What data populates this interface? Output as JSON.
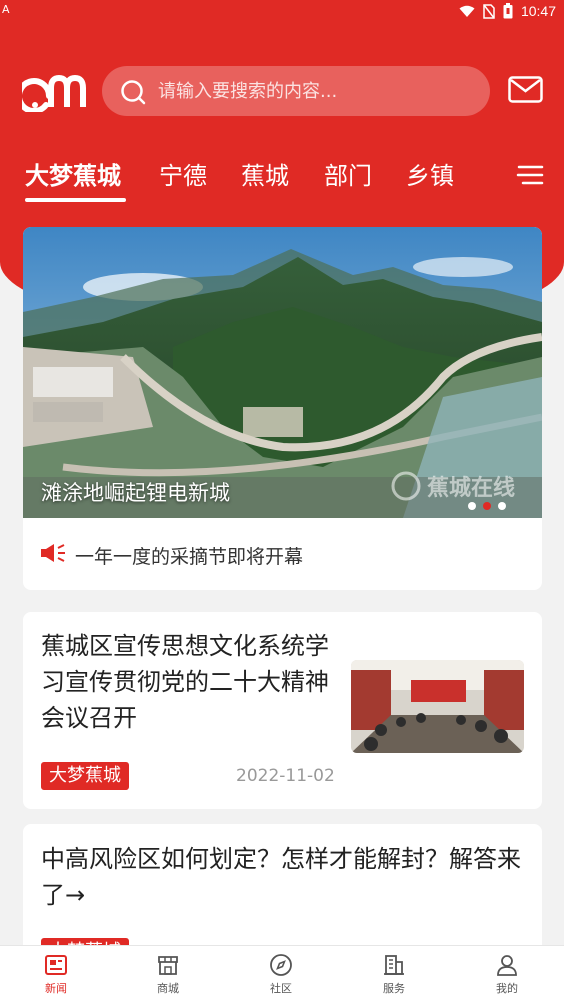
{
  "status_bar": {
    "left_icon": "A",
    "time": "10:47",
    "icons": [
      "wifi-icon",
      "sim-off-icon",
      "battery-icon"
    ]
  },
  "header": {
    "logo": "am",
    "search_placeholder": "请输入要搜索的内容...",
    "icons": [
      "search-icon",
      "mail-icon",
      "menu-icon"
    ]
  },
  "tabs": [
    {
      "label": "大梦蕉城",
      "active": true
    },
    {
      "label": "宁德",
      "active": false
    },
    {
      "label": "蕉城",
      "active": false
    },
    {
      "label": "部门",
      "active": false
    },
    {
      "label": "乡镇",
      "active": false
    }
  ],
  "banner": {
    "caption": "滩涂地崛起锂电新城",
    "watermark": "蕉城在线",
    "slide_count": 3,
    "active_slide": 2
  },
  "notice": {
    "text": "一年一度的采摘节即将开幕"
  },
  "news": [
    {
      "title": "蕉城区宣传思想文化系统学习宣传贯彻党的二十大精神会议召开",
      "tag": "大梦蕉城",
      "date": "2022-11-02"
    },
    {
      "title": "中高风险区如何划定？怎样才能解封？解答来了→",
      "tag": "大梦蕉城"
    }
  ],
  "bottom_nav": [
    {
      "label": "新闻",
      "icon": "news-icon",
      "active": true
    },
    {
      "label": "商城",
      "icon": "store-icon",
      "active": false
    },
    {
      "label": "社区",
      "icon": "compass-icon",
      "active": false
    },
    {
      "label": "服务",
      "icon": "building-icon",
      "active": false
    },
    {
      "label": "我的",
      "icon": "person-icon",
      "active": false
    }
  ],
  "colors": {
    "brand_red": "#e02a25",
    "text_dark": "#222222",
    "text_muted": "#999999"
  }
}
